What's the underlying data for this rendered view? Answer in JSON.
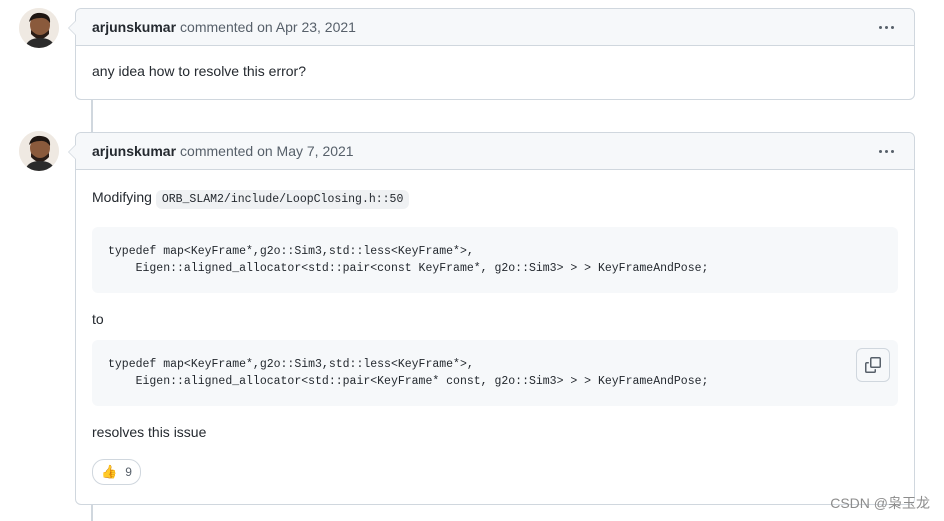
{
  "comments": [
    {
      "author": "arjunskumar",
      "meta": "commented on Apr 23, 2021",
      "body": "any idea how to resolve this error?"
    },
    {
      "author": "arjunskumar",
      "meta": "commented on May 7, 2021",
      "intro": "Modifying",
      "inline_code": "ORB_SLAM2/include/LoopClosing.h::50",
      "code_before": "typedef map<KeyFrame*,g2o::Sim3,std::less<KeyFrame*>,\n    Eigen::aligned_allocator<std::pair<const KeyFrame*, g2o::Sim3> > > KeyFrameAndPose;",
      "connector": "to",
      "code_after": "typedef map<KeyFrame*,g2o::Sim3,std::less<KeyFrame*>,\n    Eigen::aligned_allocator<std::pair<KeyFrame* const, g2o::Sim3> > > KeyFrameAndPose;",
      "closing": "resolves this issue",
      "reaction": {
        "emoji": "👍",
        "count": "9"
      }
    }
  ],
  "watermark": "CSDN @枭玉龙",
  "icons": {
    "menu": "kebab-horizontal-icon",
    "copy": "copy-icon",
    "reaction": "thumbs-up-icon"
  }
}
